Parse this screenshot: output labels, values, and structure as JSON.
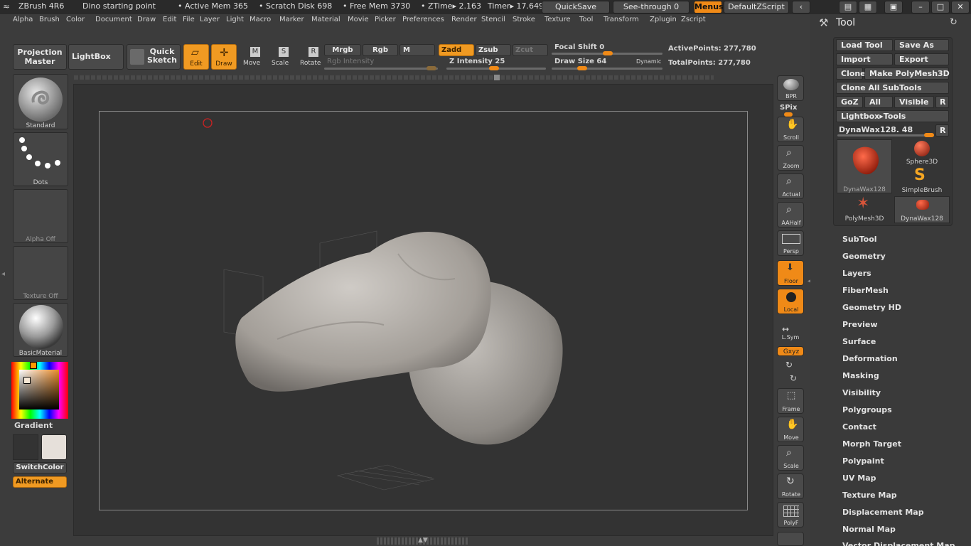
{
  "titlebar": {
    "app_title": "ZBrush 4R6",
    "doc_title": "Dino starting point",
    "active_mem": "• Active Mem 365",
    "scratch_disk": "• Scratch Disk 698",
    "free_mem": "• Free Mem 3730",
    "ztime": "• ZTime▸ 2.163",
    "timer": "Timer▸ 17.649",
    "quicksave": "QuickSave",
    "see_through": "See-through  0",
    "menus": "Menus",
    "default_zscript": "DefaultZScript"
  },
  "menu": [
    "Alpha",
    "Brush",
    "Color",
    "Document",
    "Draw",
    "Edit",
    "File",
    "Layer",
    "Light",
    "Macro",
    "Marker",
    "Material",
    "Movie",
    "Picker",
    "Preferences",
    "Render",
    "Stencil",
    "Stroke",
    "Texture",
    "Tool",
    "Transform",
    "Zplugin",
    "Zscript"
  ],
  "toolbar": {
    "projection_master": "Projection Master",
    "lightbox": "LightBox",
    "quick_sketch": "Quick Sketch",
    "edit": "Edit",
    "draw": "Draw",
    "move": "Move",
    "scale": "Scale",
    "rotate": "Rotate",
    "mrgb": "Mrgb",
    "rgb": "Rgb",
    "m": "M",
    "rgb_intensity": "Rgb Intensity",
    "zadd": "Zadd",
    "zsub": "Zsub",
    "zcut": "Zcut",
    "z_intensity": "Z Intensity 25",
    "z_intensity_value": 25,
    "focal_shift": "Focal Shift 0",
    "focal_shift_value": 0,
    "draw_size": "Draw Size 64",
    "draw_size_value": 64,
    "dynamic": "Dynamic",
    "active_points": "ActivePoints: 277,780",
    "total_points": "TotalPoints: 277,780"
  },
  "left_shelf": {
    "brush": "Standard",
    "stroke": "Dots",
    "alpha": "Alpha  Off",
    "texture": "Texture  Off",
    "material": "BasicMaterial",
    "gradient": "Gradient",
    "switch_color": "SwitchColor",
    "alternate": "Alternate"
  },
  "right_shelf": {
    "bpr": "BPR",
    "spix": "SPix",
    "scroll": "Scroll",
    "zoom": "Zoom",
    "actual": "Actual",
    "aahalf": "AAHalf",
    "persp": "Persp",
    "floor": "Floor",
    "local": "Local",
    "lsym": "L.Sym",
    "xyz": "Gxyz",
    "frame": "Frame",
    "move": "Move",
    "scale": "Scale",
    "rotate": "Rotate",
    "polyf": "PolyF"
  },
  "tool_panel": {
    "title": "Tool",
    "load_tool": "Load Tool",
    "save_as": "Save As",
    "import": "Import",
    "export": "Export",
    "clone": "Clone",
    "make_polymesh": "Make PolyMesh3D",
    "clone_all": "Clone All SubTools",
    "goz": "GoZ",
    "all": "All",
    "visible": "Visible",
    "r": "R",
    "lightbox_tools": "Lightbox▸Tools",
    "current_tool": "DynaWax128. 48",
    "thumbs": [
      "DynaWax128",
      "Sphere3D",
      "SimpleBrush",
      "PolyMesh3D",
      "DynaWax128"
    ],
    "sections": [
      "SubTool",
      "Geometry",
      "Layers",
      "FiberMesh",
      "Geometry HD",
      "Preview",
      "Surface",
      "Deformation",
      "Masking",
      "Visibility",
      "Polygroups",
      "Contact",
      "Morph Target",
      "Polypaint",
      "UV Map",
      "Texture Map",
      "Displacement Map",
      "Normal Map",
      "Vector Displacement Map"
    ]
  },
  "colors": {
    "accent": "#f08a17",
    "background": "#3c3c3c",
    "canvas": "#333333"
  }
}
